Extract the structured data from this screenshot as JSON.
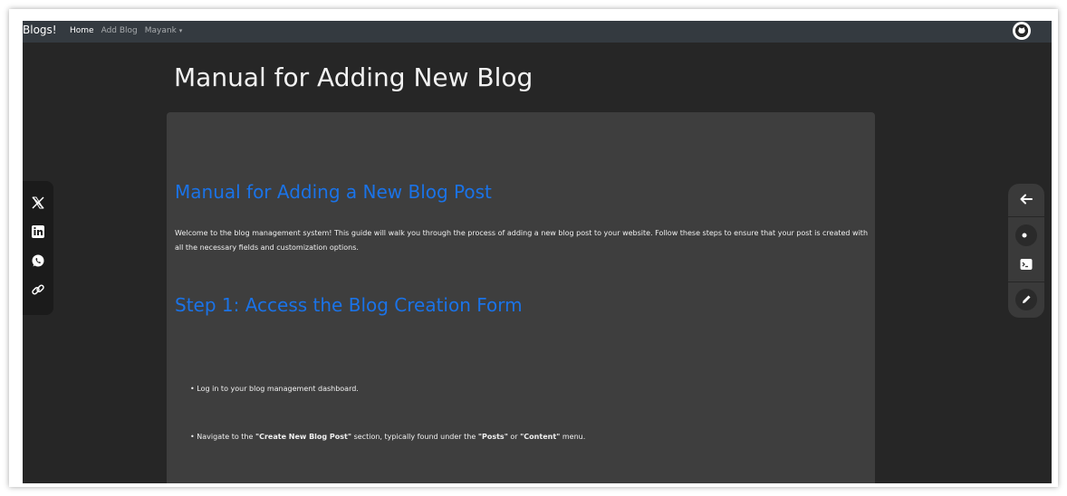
{
  "nav": {
    "brand": "Blogs!",
    "home": "Home",
    "add_blog": "Add Blog",
    "user": "Mayank",
    "caret": "▾"
  },
  "page": {
    "title": "Manual for Adding New Blog"
  },
  "article": {
    "heading": "Manual for Adding a New Blog Post",
    "intro": "Welcome to the blog management system! This guide will walk you through the process of adding a new blog post to your website. Follow these steps to ensure that your post is created with all the necessary fields and customization options.",
    "step1_heading": "Step 1: Access the Blog Creation Form",
    "bullet1": "Log in to your blog management dashboard.",
    "bullet2_pre": "Navigate to the ",
    "bullet2_b1": "\"Create New Blog Post\"",
    "bullet2_mid1": " section, typically found under the ",
    "bullet2_b2": "\"Posts\"",
    "bullet2_mid2": " or ",
    "bullet2_b3": "\"Content\"",
    "bullet2_post": " menu."
  },
  "icons": {
    "share": [
      "x-icon",
      "linkedin-icon",
      "whatsapp-icon",
      "link-icon"
    ],
    "tools": [
      "back-arrow-icon",
      "theme-toggle-icon",
      "terminal-icon",
      "edit-icon"
    ]
  },
  "colors": {
    "heading_blue": "#1a73e8",
    "navbar": "#343a40",
    "background": "#262626",
    "card": "#3e3e3e"
  }
}
